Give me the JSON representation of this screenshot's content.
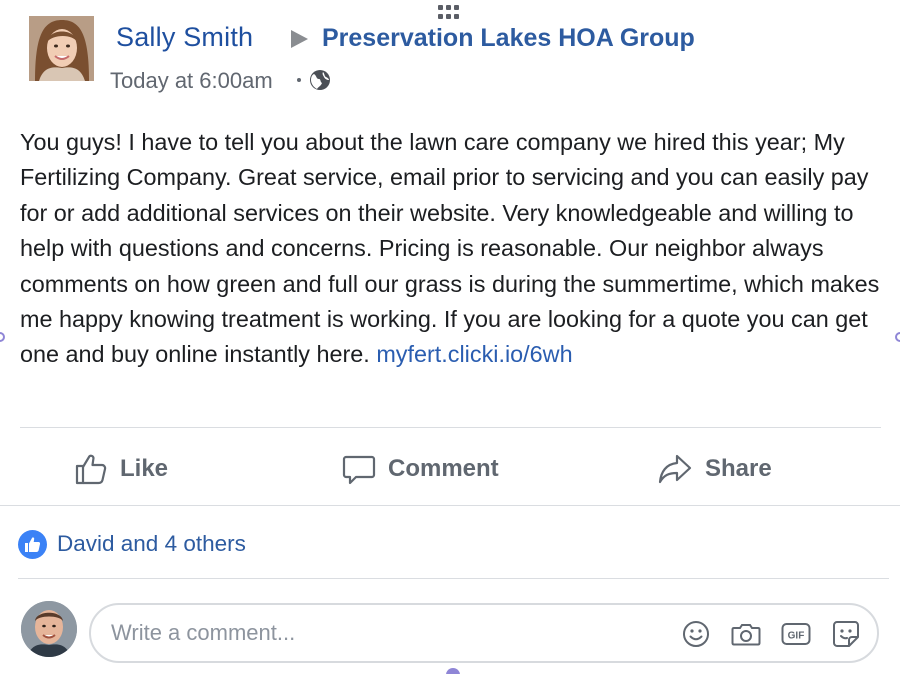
{
  "post": {
    "author": "Sally Smith",
    "group": "Preservation Lakes HOA Group",
    "timestamp": "Today at 6:00am",
    "privacy_icon": "globe-icon",
    "body_text": "You guys! I have to tell you about the lawn care company we hired this year; My Fertilizing Company. Great service, email prior to servicing and you can easily pay for or add additional services on their website. Very knowledgeable and willing to help with questions and concerns. Pricing is reasonable. Our neighbor always comments on how green and full our grass is during the summertime, which makes me happy knowing treatment is working. If you are looking for a quote you can get one and buy online instantly here.",
    "link_text": "myfert.clicki.io/6wh"
  },
  "actions": {
    "like_label": "Like",
    "comment_label": "Comment",
    "share_label": "Share"
  },
  "reactions": {
    "summary": "David and 4 others",
    "icon": "thumbs-up-icon"
  },
  "comment_box": {
    "placeholder": "Write a comment...",
    "icons": [
      "emoji-icon",
      "camera-icon",
      "gif-icon",
      "sticker-icon"
    ],
    "gif_label": "GIF"
  },
  "colors": {
    "link": "#2a5db0",
    "author": "#1e4f9f",
    "action_text": "#606770",
    "like_badge": "#3b82f6"
  }
}
